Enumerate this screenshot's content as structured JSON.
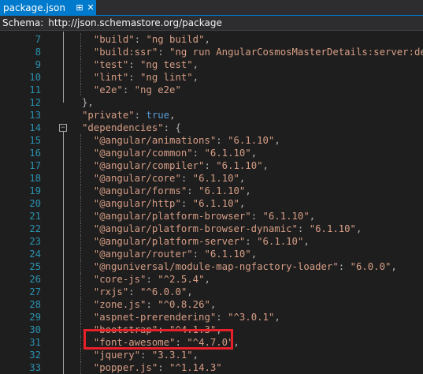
{
  "tab": {
    "title": "package.json",
    "pin_icon": "pin-icon",
    "close_icon": "close-icon"
  },
  "schema": {
    "label": "Schema:",
    "url": "http://json.schemastore.org/package"
  },
  "lines": [
    {
      "num": "7",
      "fold": "",
      "indent": 2,
      "text": "\"build\": \"ng build\","
    },
    {
      "num": "8",
      "fold": "",
      "indent": 2,
      "text": "\"build:ssr\": \"ng run AngularCosmosMasterDetails:server:dev\","
    },
    {
      "num": "9",
      "fold": "",
      "indent": 2,
      "text": "\"test\": \"ng test\","
    },
    {
      "num": "10",
      "fold": "",
      "indent": 2,
      "text": "\"lint\": \"ng lint\","
    },
    {
      "num": "11",
      "fold": "",
      "indent": 2,
      "text": "\"e2e\": \"ng e2e\""
    },
    {
      "num": "12",
      "fold": "",
      "indent": 1,
      "text": "},"
    },
    {
      "num": "13",
      "fold": "",
      "indent": 1,
      "text": "\"private\": true,"
    },
    {
      "num": "14",
      "fold": "−",
      "indent": 1,
      "text": "\"dependencies\": {"
    },
    {
      "num": "15",
      "fold": "",
      "indent": 2,
      "text": "\"@angular/animations\": \"6.1.10\","
    },
    {
      "num": "16",
      "fold": "",
      "indent": 2,
      "text": "\"@angular/common\": \"6.1.10\","
    },
    {
      "num": "17",
      "fold": "",
      "indent": 2,
      "text": "\"@angular/compiler\": \"6.1.10\","
    },
    {
      "num": "18",
      "fold": "",
      "indent": 2,
      "text": "\"@angular/core\": \"6.1.10\","
    },
    {
      "num": "19",
      "fold": "",
      "indent": 2,
      "text": "\"@angular/forms\": \"6.1.10\","
    },
    {
      "num": "20",
      "fold": "",
      "indent": 2,
      "text": "\"@angular/http\": \"6.1.10\","
    },
    {
      "num": "21",
      "fold": "",
      "indent": 2,
      "text": "\"@angular/platform-browser\": \"6.1.10\","
    },
    {
      "num": "22",
      "fold": "",
      "indent": 2,
      "text": "\"@angular/platform-browser-dynamic\": \"6.1.10\","
    },
    {
      "num": "23",
      "fold": "",
      "indent": 2,
      "text": "\"@angular/platform-server\": \"6.1.10\","
    },
    {
      "num": "24",
      "fold": "",
      "indent": 2,
      "text": "\"@angular/router\": \"6.1.10\","
    },
    {
      "num": "25",
      "fold": "",
      "indent": 2,
      "text": "\"@nguniversal/module-map-ngfactory-loader\": \"6.0.0\","
    },
    {
      "num": "26",
      "fold": "",
      "indent": 2,
      "text": "\"core-js\": \"^2.5.4\","
    },
    {
      "num": "27",
      "fold": "",
      "indent": 2,
      "text": "\"rxjs\": \"^6.0.0\","
    },
    {
      "num": "28",
      "fold": "",
      "indent": 2,
      "text": "\"zone.js\": \"^0.8.26\","
    },
    {
      "num": "29",
      "fold": "",
      "indent": 2,
      "text": "\"aspnet-prerendering\": \"^3.0.1\","
    },
    {
      "num": "30",
      "fold": "",
      "indent": 2,
      "text": "\"bootstrap\": \"^4.1.3\","
    },
    {
      "num": "31",
      "fold": "",
      "indent": 2,
      "text": "\"font-awesome\": \"^4.7.0\","
    },
    {
      "num": "32",
      "fold": "",
      "indent": 2,
      "text": "\"jquery\": \"3.3.1\","
    },
    {
      "num": "33",
      "fold": "",
      "indent": 2,
      "text": "\"popper.js\": \"^1.14.3\""
    }
  ],
  "colors": {
    "key": "#d69d85",
    "string": "#d69d85",
    "boolean": "#569cd6",
    "punctuation": "#b4b4b4",
    "line_number": "#2b91af",
    "highlight_box": "#e8202a",
    "tab_active": "#007acc"
  }
}
